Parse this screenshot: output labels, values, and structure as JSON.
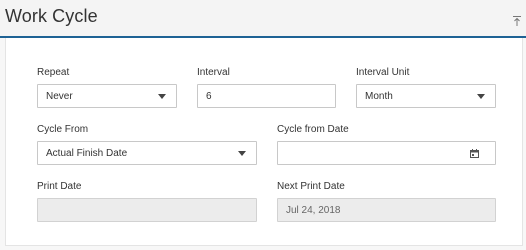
{
  "panel": {
    "title": "Work Cycle",
    "collapse_icon": "collapse-up-icon"
  },
  "fields": {
    "repeat": {
      "label": "Repeat",
      "value": "Never"
    },
    "interval": {
      "label": "Interval",
      "value": "6"
    },
    "interval_unit": {
      "label": "Interval Unit",
      "value": "Month"
    },
    "cycle_from": {
      "label": "Cycle From",
      "value": "Actual Finish Date"
    },
    "cycle_from_date": {
      "label": "Cycle from Date",
      "value": "",
      "icon": "calendar-icon"
    },
    "print_date": {
      "label": "Print Date",
      "value": ""
    },
    "next_print_date": {
      "label": "Next Print Date",
      "value": "Jul 24, 2018"
    }
  },
  "colors": {
    "header_rule": "#1e6294",
    "disabled_bg": "#ececec"
  }
}
